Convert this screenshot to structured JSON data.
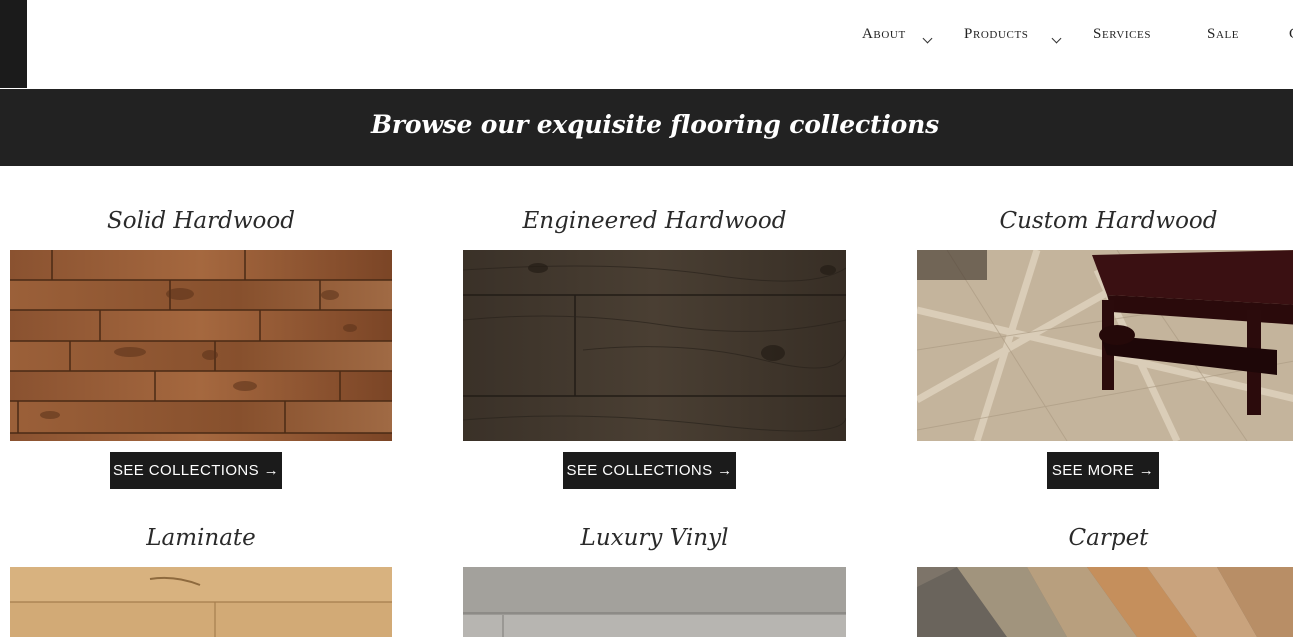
{
  "nav": {
    "items": [
      {
        "label": "About",
        "has_dropdown": true
      },
      {
        "label": "Products",
        "has_dropdown": true
      },
      {
        "label": "Services",
        "has_dropdown": false
      },
      {
        "label": "Sale",
        "has_dropdown": false
      },
      {
        "label": "C",
        "has_dropdown": false
      }
    ]
  },
  "banner": {
    "title": "Browse our exquisite flooring collections"
  },
  "collections": [
    {
      "title": "Solid Hardwood",
      "button": "SEE COLLECTIONS →",
      "image": "solid-hardwood-floor"
    },
    {
      "title": "Engineered Hardwood",
      "button": "SEE COLLECTIONS →",
      "image": "engineered-hardwood-floor"
    },
    {
      "title": "Custom Hardwood",
      "button": "SEE MORE →",
      "image": "custom-hardwood-parquet-floor"
    },
    {
      "title": "Laminate",
      "image": "laminate-floor"
    },
    {
      "title": "Luxury Vinyl",
      "image": "luxury-vinyl-floor"
    },
    {
      "title": "Carpet",
      "image": "carpet-samples"
    }
  ],
  "colors": {
    "banner_bg": "#222222",
    "button_bg": "#1b1b1b",
    "text": "#222222"
  }
}
